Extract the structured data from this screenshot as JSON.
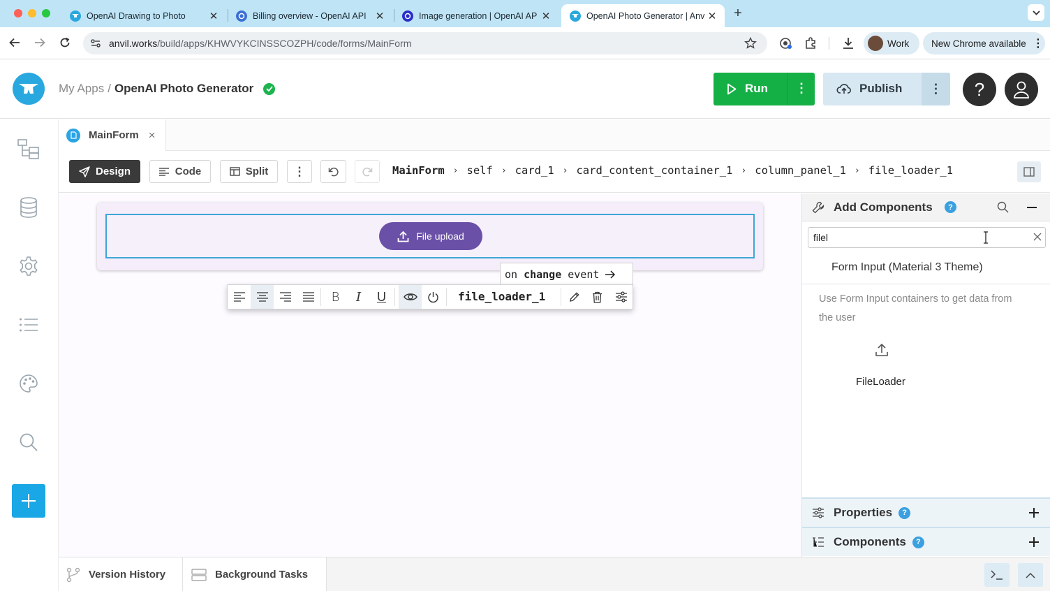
{
  "browser": {
    "tabs": [
      {
        "title": "OpenAI Drawing to Photo",
        "active": false
      },
      {
        "title": "Billing overview - OpenAI API",
        "active": false
      },
      {
        "title": "Image generation | OpenAI AP",
        "active": false
      },
      {
        "title": "OpenAI Photo Generator | Anv",
        "active": true
      }
    ],
    "url_domain": "anvil.works",
    "url_path": "/build/apps/KHWVYKCINSSCOZPH/code/forms/MainForm",
    "profile_label": "Work",
    "update_label": "New Chrome available"
  },
  "header": {
    "breadcrumb_root": "My Apps",
    "breadcrumb_sep": "/",
    "app_name": "OpenAI Photo Generator",
    "run_label": "Run",
    "publish_label": "Publish",
    "help_glyph": "?"
  },
  "file_tab": {
    "label": "MainForm",
    "close": "×"
  },
  "editor": {
    "design_label": "Design",
    "code_label": "Code",
    "split_label": "Split",
    "breadcrumbs": [
      "MainForm",
      "self",
      "card_1",
      "card_content_container_1",
      "column_panel_1",
      "file_loader_1"
    ]
  },
  "canvas": {
    "upload_label": "File upload",
    "event_on": "on",
    "event_name": "change",
    "event_word": "event",
    "component_name": "file_loader_1",
    "format_glyphs": {
      "bold": "B",
      "italic": "I",
      "underline": "U"
    }
  },
  "right_panel": {
    "title": "Add Components",
    "search_value": "filel",
    "category": "Form Input (Material 3 Theme)",
    "description": "Use Form Input containers to get data from the user",
    "component_label": "FileLoader",
    "properties_label": "Properties",
    "components_label": "Components",
    "help_glyph": "?"
  },
  "bottom": {
    "version_history_label": "Version History",
    "background_tasks_label": "Background Tasks"
  },
  "colors": {
    "run_green": "#15b045",
    "upload_purple": "#6a50a7",
    "selection_blue": "#3ea6d8",
    "anvil_blue": "#29a8e0"
  }
}
